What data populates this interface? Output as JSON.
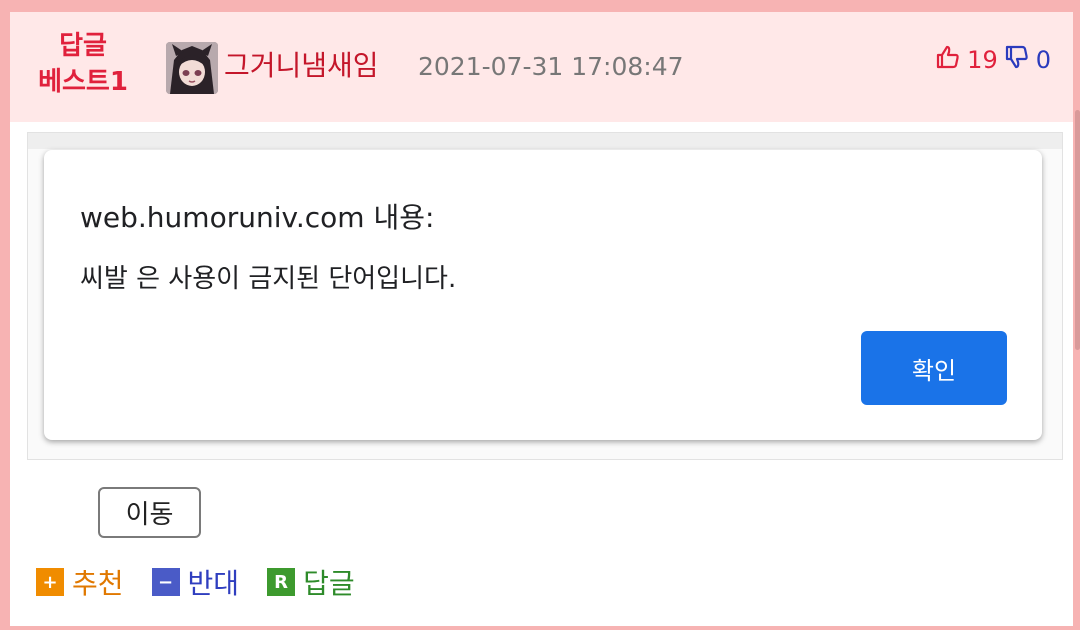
{
  "comment": {
    "best_line1": "답글",
    "best_line2": "베스트1",
    "author": "그거니냄새임",
    "datetime": "2021-07-31 17:08:47",
    "up_count": "19",
    "down_count": "0"
  },
  "dialog": {
    "origin": "web.humoruniv.com 내용:",
    "message": "씨발 은 사용이 금지된 단어입니다.",
    "ok_label": "확인"
  },
  "controls": {
    "move_label": "이동"
  },
  "actions": {
    "recommend_icon": "+",
    "recommend_label": "추천",
    "oppose_icon": "−",
    "oppose_label": "반대",
    "reply_icon": "R",
    "reply_label": "답글"
  },
  "colors": {
    "accent_red": "#e0213c",
    "dialog_button": "#1a73e8",
    "header_bg": "#ffe8e8",
    "frame": "#f7b3b3"
  },
  "icons": [
    "thumbs-up-icon",
    "thumbs-down-icon",
    "plus-icon",
    "minus-icon",
    "reply-icon"
  ]
}
